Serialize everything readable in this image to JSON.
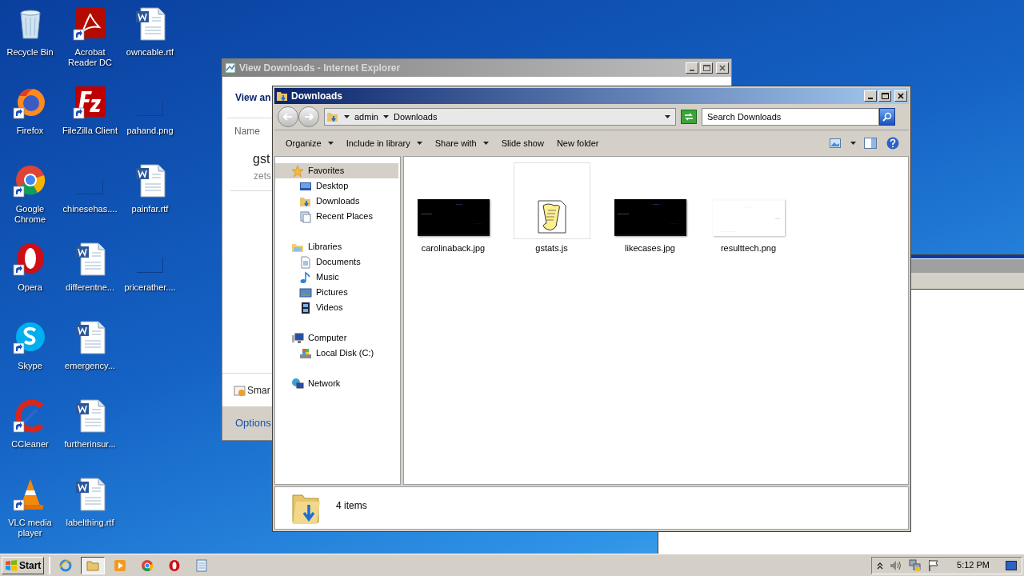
{
  "desktop": {
    "columns": [
      [
        {
          "label": "Recycle Bin",
          "kind": "recycle",
          "shortcut": false
        },
        {
          "label": "Firefox",
          "kind": "firefox",
          "shortcut": true
        },
        {
          "label": "Google Chrome",
          "kind": "chrome",
          "shortcut": true
        },
        {
          "label": "Opera",
          "kind": "opera",
          "shortcut": true
        },
        {
          "label": "Skype",
          "kind": "skype",
          "shortcut": true
        },
        {
          "label": "CCleaner",
          "kind": "ccleaner",
          "shortcut": true
        },
        {
          "label": "VLC media player",
          "kind": "vlc",
          "shortcut": true
        }
      ],
      [
        {
          "label": "Acrobat Reader DC",
          "kind": "acrobat",
          "shortcut": true
        },
        {
          "label": "FileZilla Client",
          "kind": "filezilla",
          "shortcut": true
        },
        {
          "label": "chinesehas....",
          "kind": "blank",
          "shortcut": false
        },
        {
          "label": "differentne...",
          "kind": "word",
          "shortcut": false
        },
        {
          "label": "emergency...",
          "kind": "word",
          "shortcut": false
        },
        {
          "label": "furtherinsur...",
          "kind": "word",
          "shortcut": false
        },
        {
          "label": "labelthing.rtf",
          "kind": "word",
          "shortcut": false
        }
      ],
      [
        {
          "label": "owncable.rtf",
          "kind": "word",
          "shortcut": false
        },
        {
          "label": "pahand.png",
          "kind": "blank",
          "shortcut": false
        },
        {
          "label": "painfar.rtf",
          "kind": "word",
          "shortcut": false
        },
        {
          "label": "pricerather....",
          "kind": "blank",
          "shortcut": false
        }
      ]
    ]
  },
  "ie_window": {
    "title": "View Downloads - Internet Explorer",
    "heading": "View an",
    "column_header": "Name",
    "item_name": "gst",
    "item_detail": "zets",
    "notice": "Smar",
    "options": "Options"
  },
  "explorer": {
    "title": "Downloads",
    "breadcrumb": [
      "admin",
      "Downloads"
    ],
    "search_placeholder": "Search Downloads",
    "toolbar": [
      {
        "label": "Organize",
        "dropdown": true
      },
      {
        "label": "Include in library",
        "dropdown": true
      },
      {
        "label": "Share with",
        "dropdown": true
      },
      {
        "label": "Slide show",
        "dropdown": false
      },
      {
        "label": "New folder",
        "dropdown": false
      }
    ],
    "nav": [
      {
        "label": "Favorites",
        "kind": "star",
        "selected": true,
        "children": [
          {
            "label": "Desktop",
            "kind": "desktop",
            "selected": false
          },
          {
            "label": "Downloads",
            "kind": "downloads",
            "selected": false
          },
          {
            "label": "Recent Places",
            "kind": "recent",
            "selected": false
          }
        ]
      },
      {
        "label": "Libraries",
        "kind": "libraries",
        "selected": false,
        "children": [
          {
            "label": "Documents",
            "kind": "documents",
            "selected": false
          },
          {
            "label": "Music",
            "kind": "music",
            "selected": false
          },
          {
            "label": "Pictures",
            "kind": "pictures",
            "selected": false
          },
          {
            "label": "Videos",
            "kind": "videos",
            "selected": false
          }
        ]
      },
      {
        "label": "Computer",
        "kind": "computer",
        "selected": false,
        "children": [
          {
            "label": "Local Disk (C:)",
            "kind": "disk",
            "selected": false
          }
        ]
      },
      {
        "label": "Network",
        "kind": "network",
        "selected": false
      }
    ],
    "files": [
      {
        "name": "carolinaback.jpg",
        "kind": "dark-image",
        "highlighted": false
      },
      {
        "name": "gstats.js",
        "kind": "script",
        "highlighted": true
      },
      {
        "name": "likecases.jpg",
        "kind": "dark-image",
        "highlighted": false
      },
      {
        "name": "resulttech.png",
        "kind": "light-image",
        "highlighted": false
      }
    ],
    "status": "4 items"
  },
  "taskbar": {
    "start": "Start",
    "apps": [
      {
        "kind": "ie",
        "selected": false
      },
      {
        "kind": "explorer",
        "selected": true
      },
      {
        "kind": "media",
        "selected": false
      },
      {
        "kind": "chrome",
        "selected": false
      },
      {
        "kind": "opera",
        "selected": false
      },
      {
        "kind": "notepad",
        "selected": false
      }
    ],
    "clock": "5:12 PM"
  }
}
